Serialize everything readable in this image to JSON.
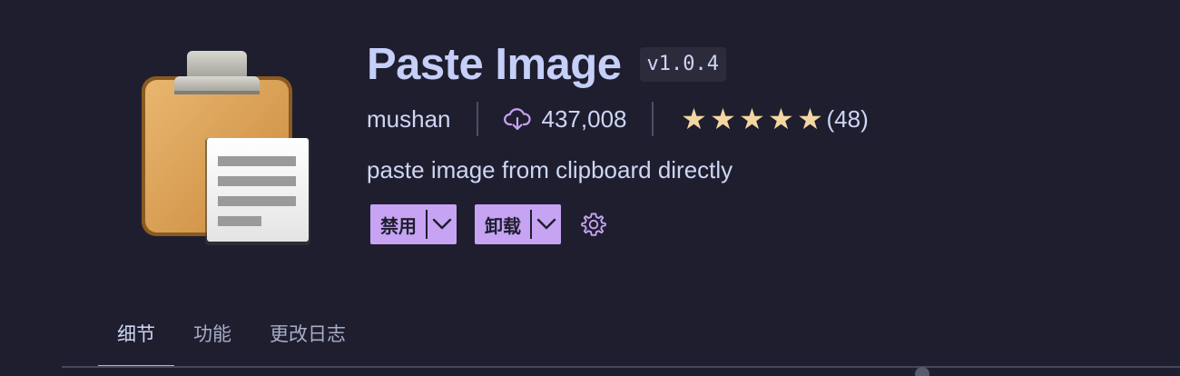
{
  "extension": {
    "name": "Paste Image",
    "version": "v1.0.4",
    "publisher": "mushan",
    "install_count": "437,008",
    "rating": {
      "stars": 5,
      "count": "(48)"
    },
    "description": "paste image from clipboard directly"
  },
  "actions": {
    "disable_label": "禁用",
    "uninstall_label": "卸载"
  },
  "tabs": [
    {
      "label": "细节",
      "active": true
    },
    {
      "label": "功能",
      "active": false
    },
    {
      "label": "更改日志",
      "active": false
    }
  ],
  "icons": {
    "extension": "clipboard-icon",
    "installs": "cloud-download-icon",
    "rating": "star-icon",
    "dropdown": "chevron-down-icon",
    "settings": "gear-icon"
  },
  "colors": {
    "background": "#1f1e2e",
    "accent": "#c7a3f3",
    "title": "#c5cff8",
    "star": "#f4d6a3"
  }
}
